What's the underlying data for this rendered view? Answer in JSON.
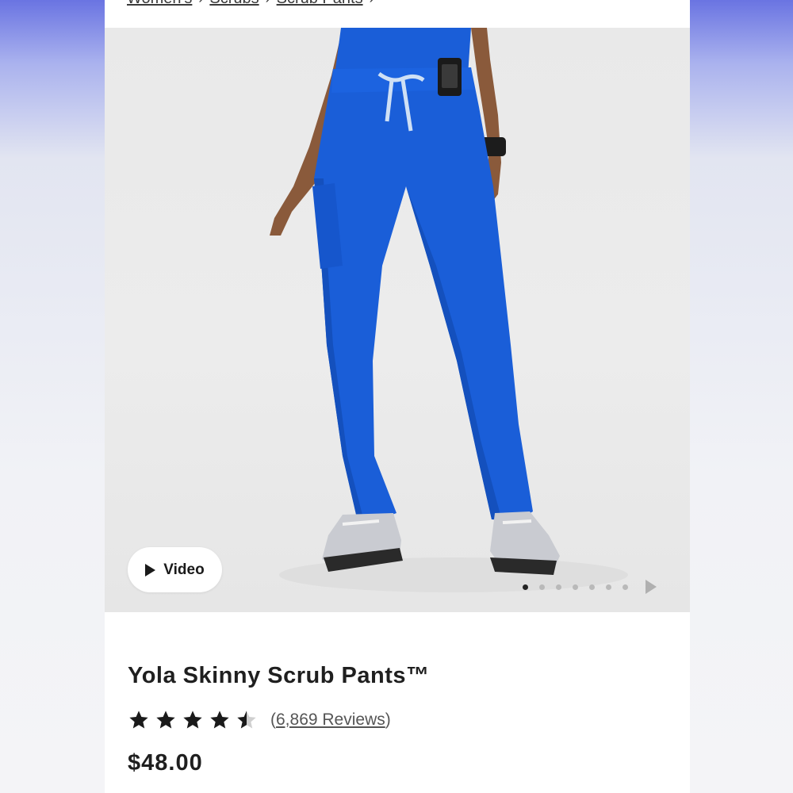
{
  "breadcrumb": {
    "items": [
      "Women's",
      "Scrubs",
      "Scrub Pants"
    ],
    "separator": "›"
  },
  "gallery": {
    "video_label": "Video",
    "slide_count": 7,
    "active_slide": 1
  },
  "product": {
    "title": "Yola Skinny Scrub Pants™",
    "rating": 4.5,
    "reviews_open": "(",
    "reviews_text": "6,869 Reviews",
    "reviews_close": ")",
    "price": "$48.00"
  },
  "colors": {
    "pants": "#1a5ed8",
    "background": "#ebebeb",
    "text": "#1f1f1f"
  },
  "icons": {
    "play": "play-icon",
    "star": "star-icon",
    "next": "chevron-right-icon"
  }
}
